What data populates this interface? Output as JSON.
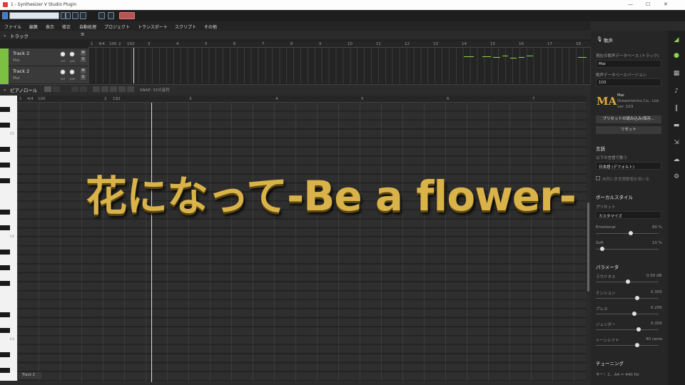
{
  "window": {
    "title": "1 - Synthesizer V Studio Plugin",
    "minimize": "—",
    "maximize": "☐",
    "close": "✕"
  },
  "menu": [
    "ファイル",
    "編集",
    "表示",
    "修正",
    "自動処理",
    "プロジェクト",
    "トランスポート",
    "スクリプト",
    "その他"
  ],
  "track_panel": {
    "title": "トラック",
    "tracks": [
      {
        "name": "Track 2",
        "voice": "Mai",
        "knob1": "vol",
        "knob2": "pan",
        "m": "M",
        "s": "S"
      },
      {
        "name": "Track 2",
        "voice": "Mai",
        "knob1": "vol",
        "knob2": "pan",
        "m": "M",
        "s": "S"
      }
    ]
  },
  "arr_ruler": {
    "tempo": "4/4",
    "bpm": "100",
    "bars": [
      "1",
      "2",
      "192",
      "3",
      "4",
      "5",
      "6",
      "7",
      "8",
      "9",
      "10",
      "11",
      "12",
      "13",
      "14",
      "15",
      "16",
      "17",
      "18"
    ]
  },
  "piano_roll": {
    "title": "ピアノロール",
    "snap": "SNAP: 32分音符",
    "tempo": "4/4",
    "bpm": "100",
    "bars": [
      "1",
      "2",
      "192",
      "3",
      "4",
      "5",
      "6",
      "7"
    ],
    "key_labels": [
      "C5",
      "C4",
      "C3"
    ],
    "track_tag": "Track 2"
  },
  "overlay_title": "花になって-Be a flower-",
  "right_panel": {
    "title": "歌声",
    "db_track_label": "現在の歌声データベース (トラック)",
    "db_value": "Mai",
    "db_version_label": "歌声データベースバージョン",
    "db_version": "103",
    "voice_name": "Mai",
    "voice_vendor": "Dreamtonics Co., Ltd.",
    "voice_ver": "ver. 103",
    "preset_button": "プリセットの読み込み/保存...",
    "reset_button": "リセット",
    "lang_title": "言語",
    "lang_label": "以下の言語で歌う",
    "lang_value": "日本語 (デフォルト)",
    "lang_check": "自然に多言語歌唱を用いる",
    "vocal_title": "ボーカルスタイル",
    "preset_label": "プリセット",
    "preset_value": "カスタマイズ",
    "emotional_label": "Emotional",
    "emotional_value": "80 %",
    "soft_label": "Soft",
    "soft_value": "10 %",
    "param_title": "パラメータ",
    "params": [
      {
        "name": "ラウドネス",
        "value": "0.00 dB"
      },
      {
        "name": "テンション",
        "value": "0.300"
      },
      {
        "name": "ブレス",
        "value": "0.200"
      },
      {
        "name": "ジェンダー",
        "value": "0.350"
      },
      {
        "name": "トーンシフト",
        "value": "40 cents"
      }
    ],
    "tuning_title": "チューニング",
    "tuning_value": "キー：C、A4 = 440 Hz"
  },
  "icons": {
    "logo": "sv-logo-icon",
    "mic": "mic-icon",
    "film": "film-icon",
    "note": "note-icon",
    "library": "library-icon",
    "book": "book-icon",
    "export": "export-icon",
    "cloud": "cloud-icon",
    "gear": "gear-icon"
  }
}
